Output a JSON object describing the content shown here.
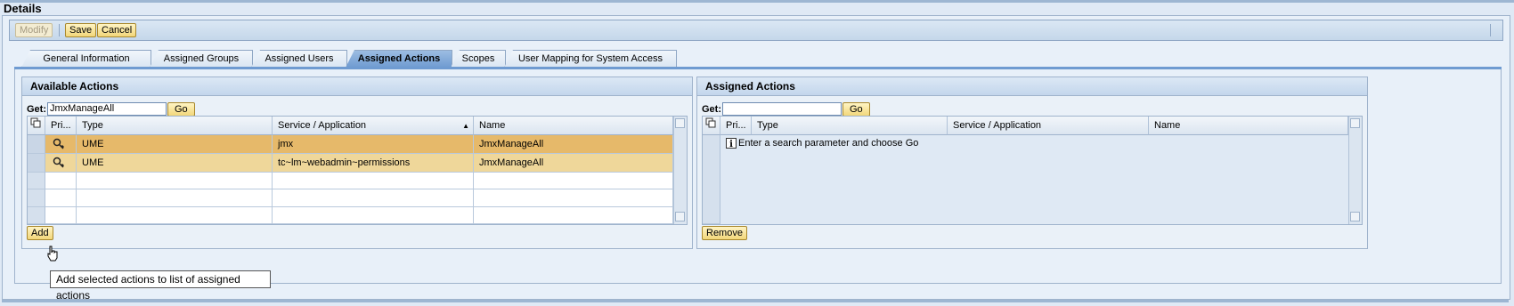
{
  "page": {
    "title": "Details"
  },
  "toolbar": {
    "modify_label": "Modify",
    "save_label": "Save",
    "cancel_label": "Cancel"
  },
  "tabs": [
    {
      "label": "General Information"
    },
    {
      "label": "Assigned Groups"
    },
    {
      "label": "Assigned Users"
    },
    {
      "label": "Assigned Actions"
    },
    {
      "label": "Scopes"
    },
    {
      "label": "User Mapping for System Access"
    }
  ],
  "available": {
    "title": "Available Actions",
    "get_label": "Get:",
    "search_value": "JmxManageAll",
    "go_label": "Go",
    "columns": [
      "Pri...",
      "Type",
      "Service / Application",
      "Name"
    ],
    "rows": [
      {
        "type": "UME",
        "service": "jmx",
        "name": "JmxManageAll"
      },
      {
        "type": "UME",
        "service": "tc~lm~webadmin~permissions",
        "name": "JmxManageAll"
      }
    ],
    "add_label": "Add"
  },
  "assigned": {
    "title": "Assigned Actions",
    "get_label": "Get:",
    "search_value": "",
    "go_label": "Go",
    "columns": [
      "Pri...",
      "Type",
      "Service / Application",
      "Name"
    ],
    "empty_message": "Enter a search parameter and choose Go",
    "remove_label": "Remove"
  },
  "tooltip": {
    "text": "Add selected actions to list of assigned actions"
  },
  "colors": {
    "selected_row": "#e6b96a",
    "second_row": "#efd79a",
    "active_tab": "#6f9bd1"
  }
}
